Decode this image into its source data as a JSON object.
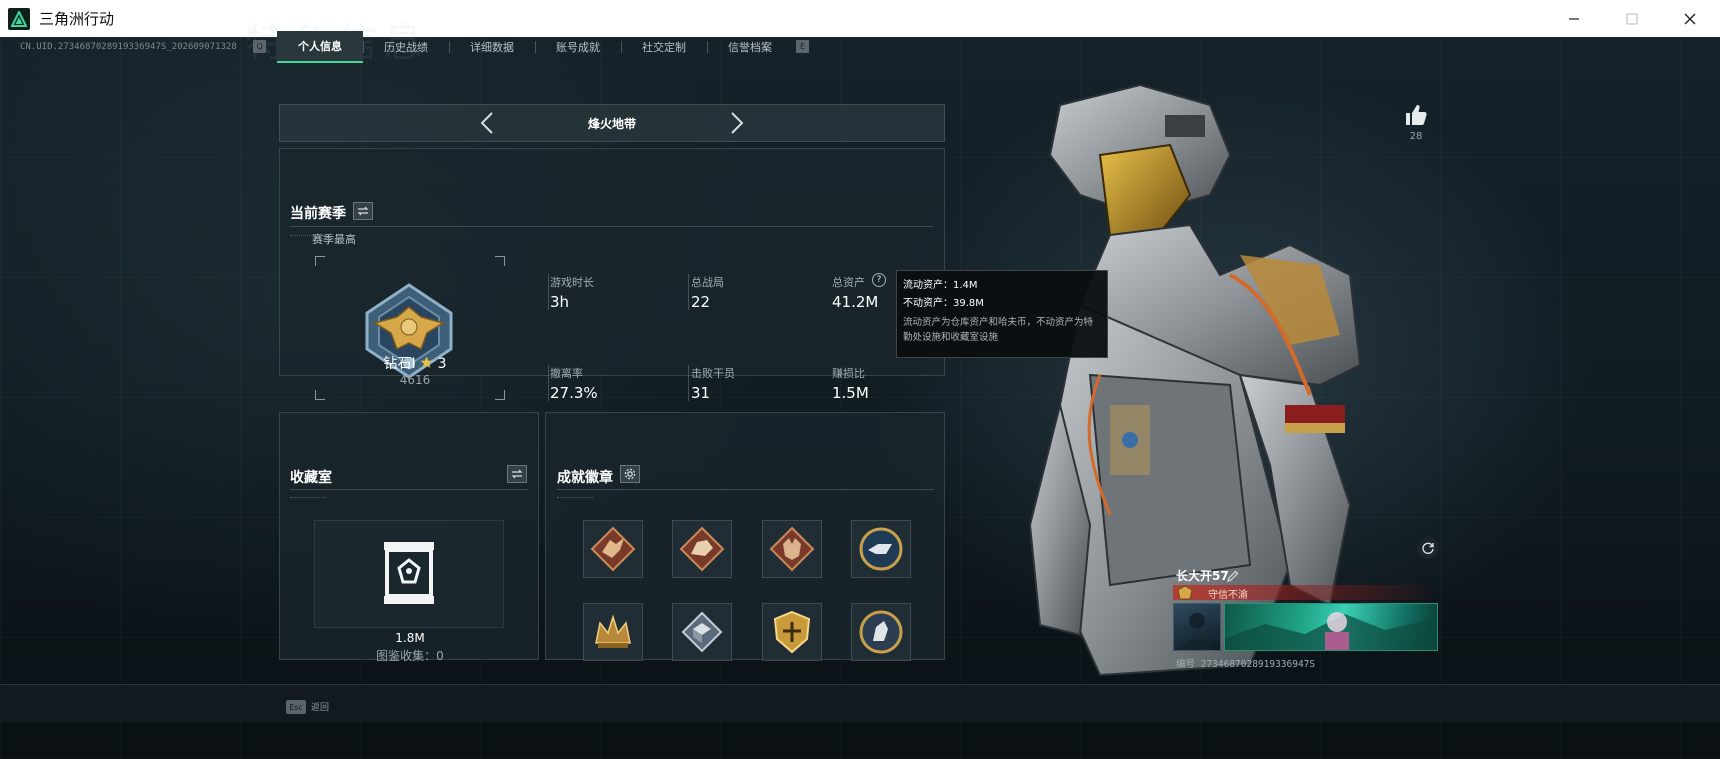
{
  "window": {
    "title": "三角洲行动",
    "min_label": "—",
    "close_label": "✕"
  },
  "uid": "CN.UID.2734687028919336947S_202609071328",
  "tabs": [
    {
      "label": "个人信息",
      "active": true
    },
    {
      "label": "历史战绩",
      "active": false
    },
    {
      "label": "详细数据",
      "active": false
    },
    {
      "label": "账号成就",
      "active": false
    },
    {
      "label": "社交定制",
      "active": false
    },
    {
      "label": "信誉档案",
      "active": false
    }
  ],
  "tab_keys": {
    "left": "Q",
    "right": "E"
  },
  "mode": {
    "label": "烽火地带"
  },
  "season": {
    "title": "当前赛季",
    "high_label": "赛季最高",
    "rank_name": "钻石Ⅰ",
    "rank_stars": "3",
    "rank_points": "4616",
    "stats": [
      {
        "label": "游戏时长",
        "value": "3h"
      },
      {
        "label": "总战局",
        "value": "22"
      },
      {
        "label": "总资产",
        "value": "41.2M"
      },
      {
        "label": "撤离率",
        "value": "27.3%"
      },
      {
        "label": "击败干员",
        "value": "31"
      },
      {
        "label": "赚损比",
        "value": "1.5M"
      }
    ]
  },
  "tooltip": {
    "line1": "流动资产：1.4M",
    "line2": "不动资产：39.8M",
    "desc": "流动资产为仓库资产和哈夫币，不动资产为特勤处设施和收藏室设施"
  },
  "collection": {
    "title": "收藏室",
    "value": "1.8M",
    "count": "图鉴收集：0"
  },
  "badges": {
    "title": "成就徽章",
    "icons": [
      "dragon-badge-icon",
      "charging-beast-badge-icon",
      "wolf-badge-icon",
      "eagle-round-badge-icon",
      "crown-badge-icon",
      "cube-badge-icon",
      "gold-shield-badge-icon",
      "horse-round-badge-icon"
    ]
  },
  "likes": {
    "count": "28"
  },
  "player": {
    "name": "长大开57",
    "title": "守信不渝",
    "uid": "编号 2734687028919336947S"
  },
  "bottom": {
    "esc_key": "Esc",
    "esc_label": "返回"
  },
  "colors": {
    "accent": "#3fd6a0",
    "gold": "#d6a84a",
    "title_red": "#be3228"
  }
}
